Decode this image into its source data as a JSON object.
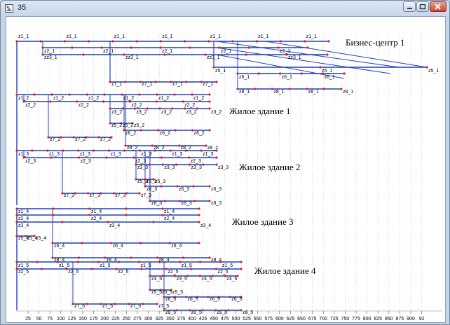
{
  "window": {
    "title": "35"
  },
  "axis": {
    "ticks": [
      "25",
      "50",
      "75",
      "100",
      "125",
      "150",
      "175",
      "200",
      "225",
      "250",
      "275",
      "300",
      "325",
      "350",
      "375",
      "400",
      "425",
      "450",
      "475",
      "500",
      "525",
      "550",
      "575",
      "600",
      "625",
      "650",
      "675",
      "700",
      "725",
      "750",
      "775",
      "800",
      "825",
      "850",
      "875",
      "900",
      "92"
    ]
  },
  "buildings": [
    {
      "name": "Бизнес-центр 1",
      "rows": [
        {
          "label": "z1_1",
          "count": 14
        },
        {
          "label": "z2_1",
          "count": 10
        },
        {
          "label": "zz3_1",
          "count": 8
        },
        {
          "label": "z5_1",
          "count": 3
        },
        {
          "label": "z6_1",
          "count": 6
        },
        {
          "label": "z7_1",
          "count": 8
        },
        {
          "label": "z8_1",
          "count": 7
        }
      ]
    },
    {
      "name": "Жилое здание 1",
      "rows": [
        {
          "label": "z1_2",
          "count": 12
        },
        {
          "label": "z2_2",
          "count": 8
        },
        {
          "label": "z3_2",
          "count": 9
        },
        {
          "label": "z5_2",
          "count": 3
        },
        {
          "label": "z6_2",
          "count": 6
        },
        {
          "label": "z7_2",
          "count": 6
        },
        {
          "label": "z8_2",
          "count": 4
        }
      ]
    },
    {
      "name": "Жилое здание 2",
      "rows": [
        {
          "label": "z1_3",
          "count": 14
        },
        {
          "label": "z2_3",
          "count": 8
        },
        {
          "label": "z3_3",
          "count": 7
        },
        {
          "label": "z5_3",
          "count": 3
        },
        {
          "label": "z6_3",
          "count": 5
        },
        {
          "label": "z7_3",
          "count": 7
        },
        {
          "label": "z8_3",
          "count": 5
        }
      ]
    },
    {
      "name": "Жилое здание 3",
      "rows": [
        {
          "label": "z1_4",
          "count": 6
        },
        {
          "label": "z2_4",
          "count": 6
        },
        {
          "label": "z3_4",
          "count": 5
        },
        {
          "label": "z5_4",
          "count": 3
        },
        {
          "label": "z6_4",
          "count": 6
        },
        {
          "label": "z8_4",
          "count": 7
        }
      ]
    },
    {
      "name": "Жилое здание 4",
      "rows": [
        {
          "label": "z1_5",
          "count": 12
        },
        {
          "label": "z2_5",
          "count": 10
        },
        {
          "label": "z3_5",
          "count": 8
        },
        {
          "label": "z5_5",
          "count": 3
        },
        {
          "label": "z6_5",
          "count": 8
        },
        {
          "label": "z7_5",
          "count": 7
        },
        {
          "label": "z8_5",
          "count": 7
        }
      ]
    }
  ]
}
